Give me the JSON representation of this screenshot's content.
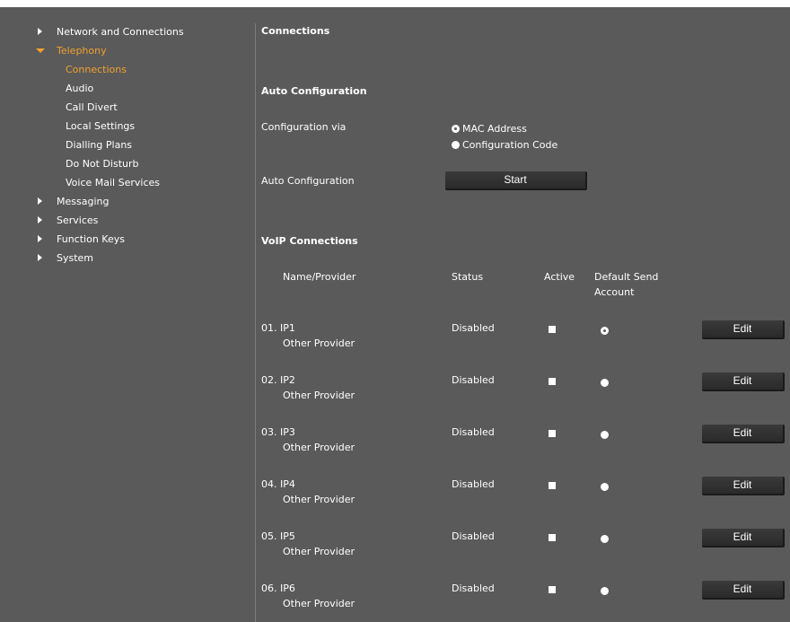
{
  "sidebar": {
    "items": [
      {
        "label": "Network and Connections"
      },
      {
        "label": "Telephony"
      },
      {
        "label": "Connections"
      },
      {
        "label": "Audio"
      },
      {
        "label": "Call Divert"
      },
      {
        "label": "Local Settings"
      },
      {
        "label": "Dialling Plans"
      },
      {
        "label": "Do Not Disturb"
      },
      {
        "label": "Voice Mail Services"
      },
      {
        "label": "Messaging"
      },
      {
        "label": "Services"
      },
      {
        "label": "Function Keys"
      },
      {
        "label": "System"
      }
    ]
  },
  "main": {
    "title": "Connections",
    "auto_config": {
      "heading": "Auto Configuration",
      "config_via_label": "Configuration via",
      "option_mac": "MAC Address",
      "option_code": "Configuration Code",
      "selected_option": "MAC Address",
      "auto_label": "Auto Configuration",
      "start_button": "Start"
    },
    "voip": {
      "heading": "VoIP Connections",
      "columns": {
        "name": "Name/Provider",
        "status": "Status",
        "active": "Active",
        "default_line1": "Default Send",
        "default_line2": "Account"
      },
      "rows": [
        {
          "id": "01. IP1",
          "provider": "Other Provider",
          "status": "Disabled",
          "default_selected": true,
          "edit": "Edit"
        },
        {
          "id": "02. IP2",
          "provider": "Other Provider",
          "status": "Disabled",
          "default_selected": false,
          "edit": "Edit"
        },
        {
          "id": "03. IP3",
          "provider": "Other Provider",
          "status": "Disabled",
          "default_selected": false,
          "edit": "Edit"
        },
        {
          "id": "04. IP4",
          "provider": "Other Provider",
          "status": "Disabled",
          "default_selected": false,
          "edit": "Edit"
        },
        {
          "id": "05. IP5",
          "provider": "Other Provider",
          "status": "Disabled",
          "default_selected": false,
          "edit": "Edit"
        },
        {
          "id": "06. IP6",
          "provider": "Other Provider",
          "status": "Disabled",
          "default_selected": false,
          "edit": "Edit"
        }
      ]
    }
  },
  "colors": {
    "background": "#5a5a5a",
    "accent": "#f0a030",
    "text": "#ffffff",
    "button": "#2f2f2f"
  }
}
